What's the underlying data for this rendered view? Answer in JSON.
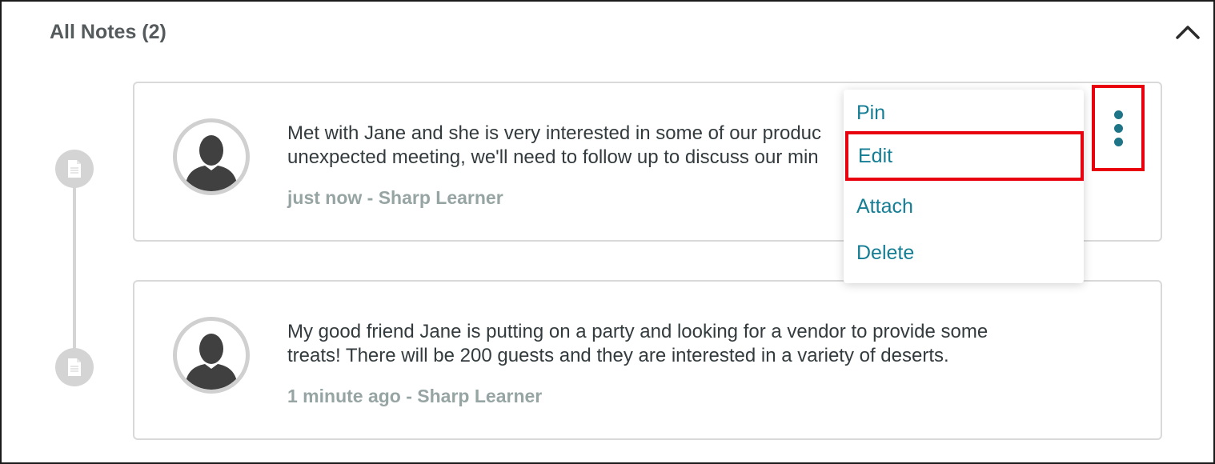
{
  "section": {
    "title": "All Notes (2)",
    "collapse_icon": "chevron-up-icon"
  },
  "notes": [
    {
      "text": "Met with Jane and she is very interested in some of our products. Due to the unexpected meeting, we'll need to follow up to discuss our minimum order",
      "line1": "Met with Jane and she is very interested in some of our produc",
      "line2": "unexpected meeting, we'll need to follow up to discuss our min",
      "meta": "just now - Sharp Learner",
      "icon": "document-icon"
    },
    {
      "line1": "My good friend Jane is putting on a party and looking for a vendor to provide some",
      "line2": "treats! There will be 200 guests and they are interested in a variety of deserts.",
      "meta": "1 minute ago - Sharp Learner",
      "icon": "document-icon"
    }
  ],
  "menu": {
    "items": [
      "Pin",
      "Edit",
      "Attach",
      "Delete"
    ]
  },
  "colors": {
    "accent": "#167e94",
    "highlight": "#e8000f",
    "meta_text": "#96a5a3",
    "border": "#d9d9d9"
  }
}
